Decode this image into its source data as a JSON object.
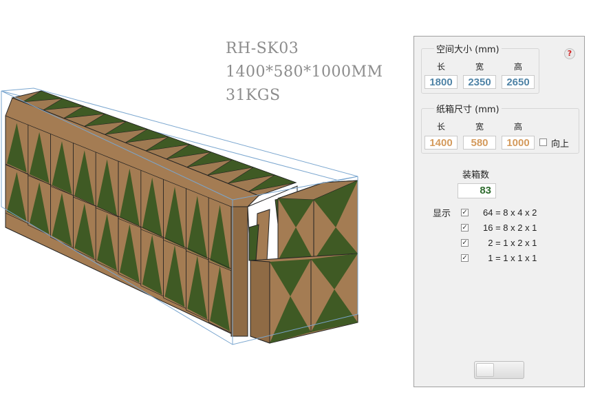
{
  "overlay": {
    "model": "RH-SK03",
    "dimensions": "1400*580*1000MM",
    "weight": "31KGS"
  },
  "panel": {
    "space": {
      "title": "空间大小 (mm)",
      "col_length": "长",
      "col_width": "宽",
      "col_height": "高",
      "length": "1800",
      "width": "2350",
      "height": "2650"
    },
    "help_icon": "?",
    "carton": {
      "title": "纸箱尺寸 (mm)",
      "col_length": "长",
      "col_width": "宽",
      "col_height": "高",
      "length": "1400",
      "width": "580",
      "height": "1000",
      "upright_label": "向上",
      "upright_checked": false
    },
    "count": {
      "label": "装箱数",
      "value": "83"
    },
    "display": {
      "label": "显示",
      "rows": [
        {
          "text": "64 = 8 x 4 x 2",
          "checked": true
        },
        {
          "text": "16 = 8 x 2 x 1",
          "checked": true
        },
        {
          "text": "  2 = 1 x 2 x 1",
          "checked": true
        },
        {
          "text": "  1 = 1 x 1 x 1",
          "checked": true
        }
      ]
    }
  },
  "colors": {
    "carton_face": "#a47c53",
    "carton_top": "#9f7a52",
    "triangle_green": "#3f5a24",
    "outline": "#222222",
    "container_line": "#7aa6cf",
    "input_blue": "#4f83a6",
    "input_orange": "#d49a5c",
    "count_green": "#2e6b2e"
  }
}
